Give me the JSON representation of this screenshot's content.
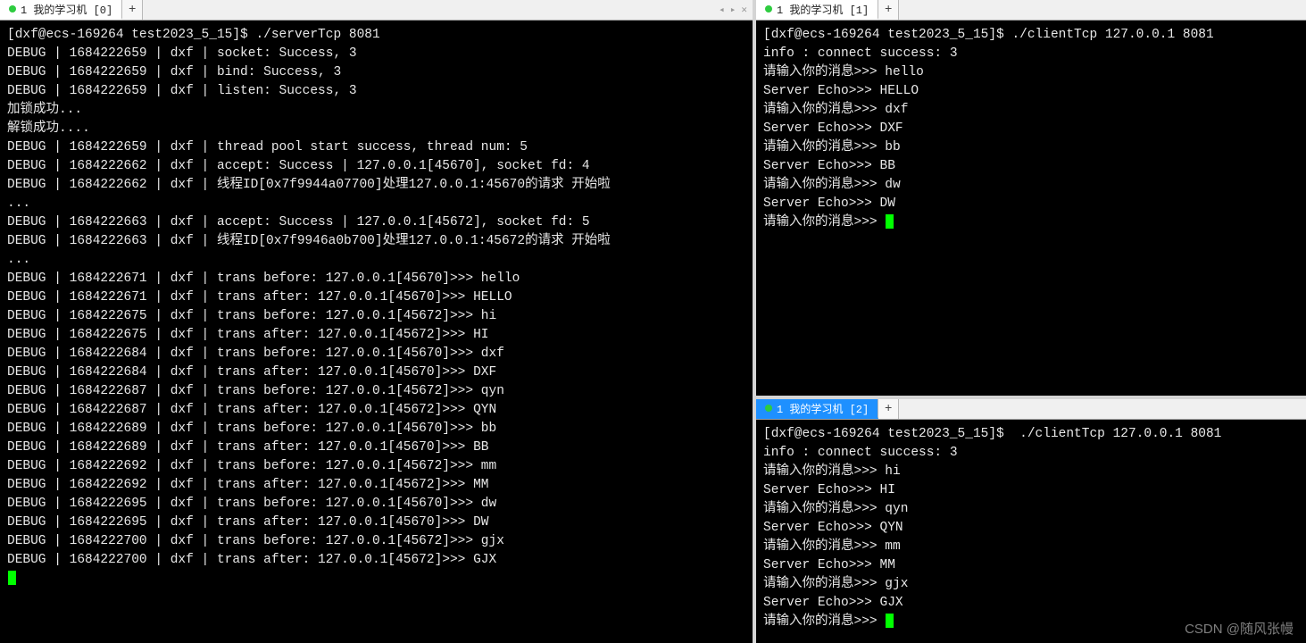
{
  "watermark": "CSDN @随风张幔",
  "panes": {
    "left": {
      "tab_label": "1 我的学习机 [0]",
      "add_label": "+",
      "nav_prev": "◂",
      "nav_next": "▸",
      "nav_close": "✕",
      "lines": [
        "[dxf@ecs-169264 test2023_5_15]$ ./serverTcp 8081",
        "DEBUG | 1684222659 | dxf | socket: Success, 3",
        "DEBUG | 1684222659 | dxf | bind: Success, 3",
        "DEBUG | 1684222659 | dxf | listen: Success, 3",
        "加锁成功...",
        "解锁成功....",
        "DEBUG | 1684222659 | dxf | thread pool start success, thread num: 5",
        "DEBUG | 1684222662 | dxf | accept: Success | 127.0.0.1[45670], socket fd: 4",
        "DEBUG | 1684222662 | dxf | 线程ID[0x7f9944a07700]处理127.0.0.1:45670的请求 开始啦",
        "...",
        "DEBUG | 1684222663 | dxf | accept: Success | 127.0.0.1[45672], socket fd: 5",
        "DEBUG | 1684222663 | dxf | 线程ID[0x7f9946a0b700]处理127.0.0.1:45672的请求 开始啦",
        "...",
        "DEBUG | 1684222671 | dxf | trans before: 127.0.0.1[45670]>>> hello",
        "DEBUG | 1684222671 | dxf | trans after: 127.0.0.1[45670]>>> HELLO",
        "DEBUG | 1684222675 | dxf | trans before: 127.0.0.1[45672]>>> hi",
        "DEBUG | 1684222675 | dxf | trans after: 127.0.0.1[45672]>>> HI",
        "DEBUG | 1684222684 | dxf | trans before: 127.0.0.1[45670]>>> dxf",
        "DEBUG | 1684222684 | dxf | trans after: 127.0.0.1[45670]>>> DXF",
        "DEBUG | 1684222687 | dxf | trans before: 127.0.0.1[45672]>>> qyn",
        "DEBUG | 1684222687 | dxf | trans after: 127.0.0.1[45672]>>> QYN",
        "DEBUG | 1684222689 | dxf | trans before: 127.0.0.1[45670]>>> bb",
        "DEBUG | 1684222689 | dxf | trans after: 127.0.0.1[45670]>>> BB",
        "DEBUG | 1684222692 | dxf | trans before: 127.0.0.1[45672]>>> mm",
        "DEBUG | 1684222692 | dxf | trans after: 127.0.0.1[45672]>>> MM",
        "DEBUG | 1684222695 | dxf | trans before: 127.0.0.1[45670]>>> dw",
        "DEBUG | 1684222695 | dxf | trans after: 127.0.0.1[45670]>>> DW",
        "DEBUG | 1684222700 | dxf | trans before: 127.0.0.1[45672]>>> gjx",
        "DEBUG | 1684222700 | dxf | trans after: 127.0.0.1[45672]>>> GJX"
      ]
    },
    "top_right": {
      "tab_label": "1 我的学习机 [1]",
      "add_label": "+",
      "lines": [
        "[dxf@ecs-169264 test2023_5_15]$ ./clientTcp 127.0.0.1 8081",
        "info : connect success: 3",
        "请输入你的消息>>> hello",
        "Server Echo>>> HELLO",
        "请输入你的消息>>> dxf",
        "Server Echo>>> DXF",
        "请输入你的消息>>> bb",
        "Server Echo>>> BB",
        "请输入你的消息>>> dw",
        "Server Echo>>> DW",
        "请输入你的消息>>> "
      ]
    },
    "bottom_right": {
      "tab_label": "1 我的学习机 [2]",
      "add_label": "+",
      "lines": [
        "[dxf@ecs-169264 test2023_5_15]$  ./clientTcp 127.0.0.1 8081",
        "info : connect success: 3",
        "请输入你的消息>>> hi",
        "Server Echo>>> HI",
        "请输入你的消息>>> qyn",
        "Server Echo>>> QYN",
        "请输入你的消息>>> mm",
        "Server Echo>>> MM",
        "请输入你的消息>>> gjx",
        "Server Echo>>> GJX",
        "请输入你的消息>>> "
      ]
    }
  }
}
